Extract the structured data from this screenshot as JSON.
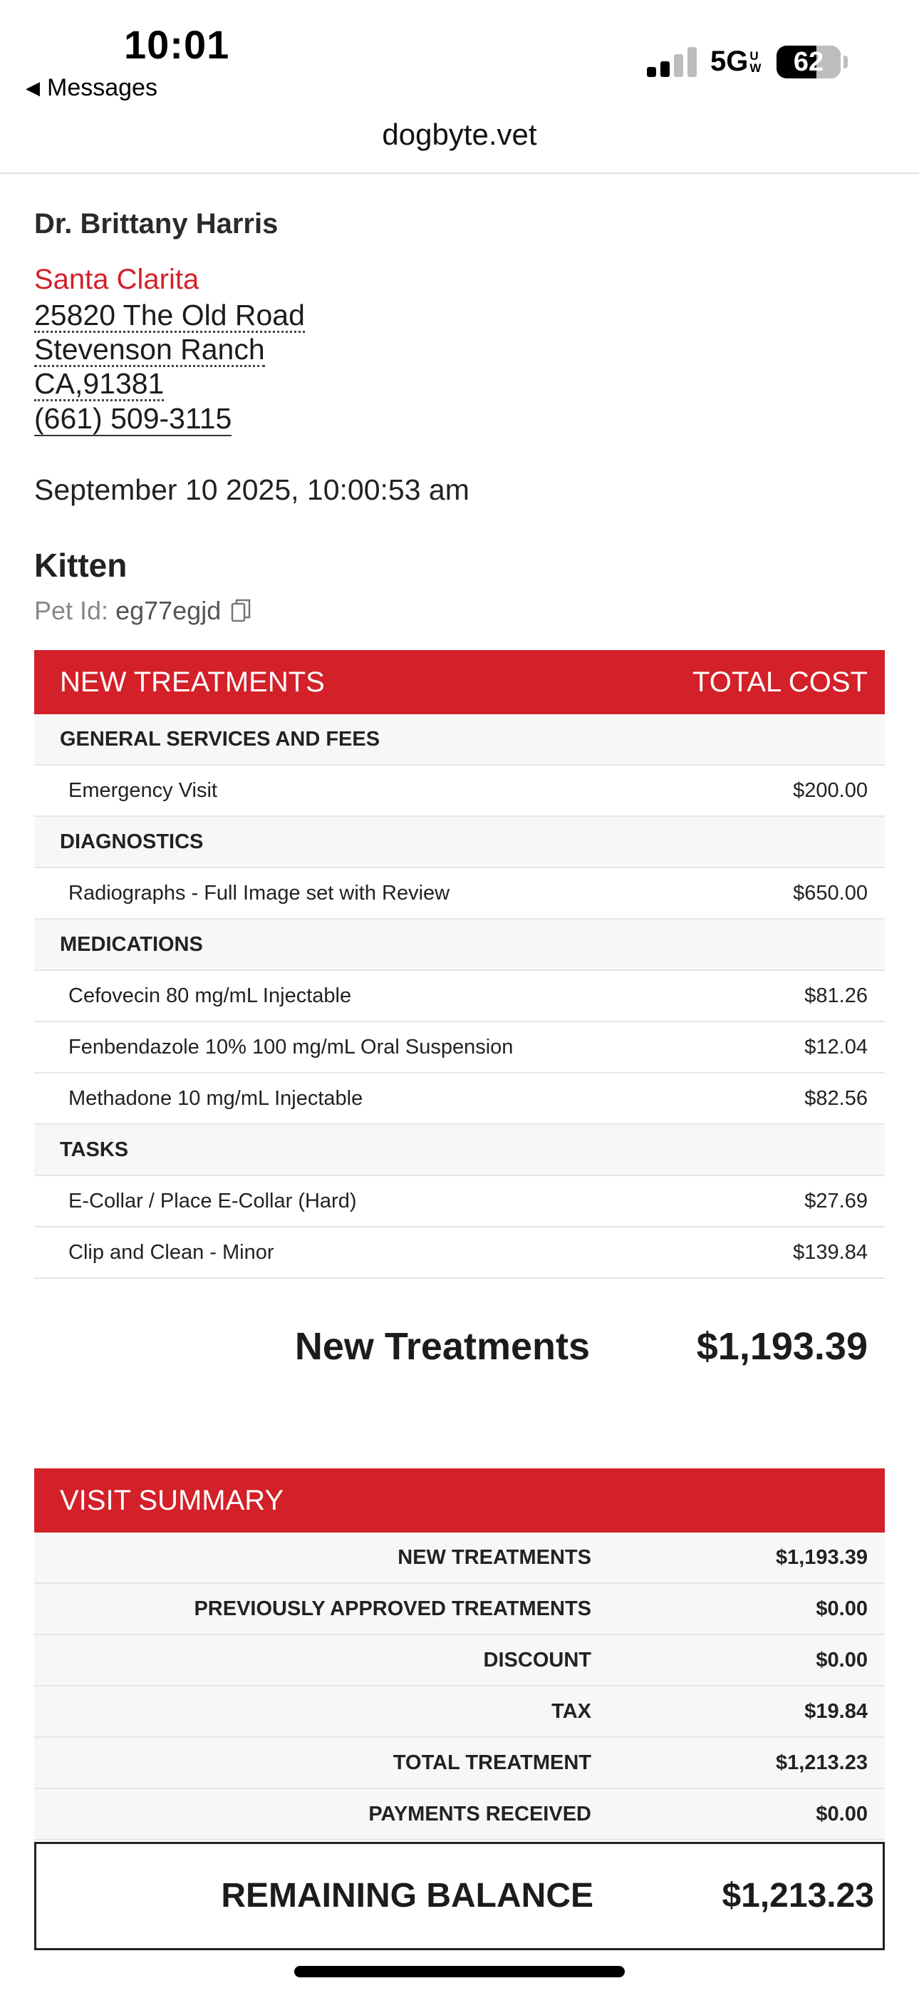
{
  "status_bar": {
    "time": "10:01",
    "back_label": "Messages",
    "network": "5G",
    "network_badge": "UW",
    "battery": "62"
  },
  "browser": {
    "url": "dogbyte.vet"
  },
  "clinic": {
    "doctor": "Dr. Brittany Harris",
    "name": "Santa Clarita",
    "address_line1": "25820 The Old Road",
    "address_line2": "Stevenson Ranch",
    "address_line3": "CA,91381",
    "phone": "(661) 509-3115"
  },
  "visit": {
    "datetime": "September 10 2025, 10:00:53 am"
  },
  "pet": {
    "name": "Kitten",
    "id_label": "Pet Id:",
    "id_value": "eg77egjd"
  },
  "treatments": {
    "header_left": "NEW TREATMENTS",
    "header_right": "TOTAL COST",
    "categories": [
      {
        "name": "GENERAL SERVICES AND FEES",
        "items": [
          {
            "label": "Emergency Visit",
            "price": "$200.00"
          }
        ]
      },
      {
        "name": "DIAGNOSTICS",
        "items": [
          {
            "label": "Radiographs - Full Image set with Review",
            "price": "$650.00"
          }
        ]
      },
      {
        "name": "MEDICATIONS",
        "items": [
          {
            "label": "Cefovecin 80 mg/mL Injectable",
            "price": "$81.26"
          },
          {
            "label": "Fenbendazole 10% 100 mg/mL Oral Suspension",
            "price": "$12.04"
          },
          {
            "label": "Methadone 10 mg/mL Injectable",
            "price": "$82.56"
          }
        ]
      },
      {
        "name": "TASKS",
        "items": [
          {
            "label": "E-Collar / Place E-Collar (Hard)",
            "price": "$27.69"
          },
          {
            "label": "Clip and Clean - Minor",
            "price": "$139.84"
          }
        ]
      }
    ],
    "total_label": "New Treatments",
    "total_amount": "$1,193.39"
  },
  "summary": {
    "header": "VISIT SUMMARY",
    "rows": [
      {
        "label": "NEW TREATMENTS",
        "amount": "$1,193.39"
      },
      {
        "label": "PREVIOUSLY APPROVED TREATMENTS",
        "amount": "$0.00"
      },
      {
        "label": "DISCOUNT",
        "amount": "$0.00"
      },
      {
        "label": "TAX",
        "amount": "$19.84"
      },
      {
        "label": "TOTAL TREATMENT",
        "amount": "$1,213.23"
      },
      {
        "label": "PAYMENTS RECEIVED",
        "amount": "$0.00"
      }
    ],
    "balance_label": "REMAINING BALANCE",
    "balance_amount": "$1,213.23"
  }
}
